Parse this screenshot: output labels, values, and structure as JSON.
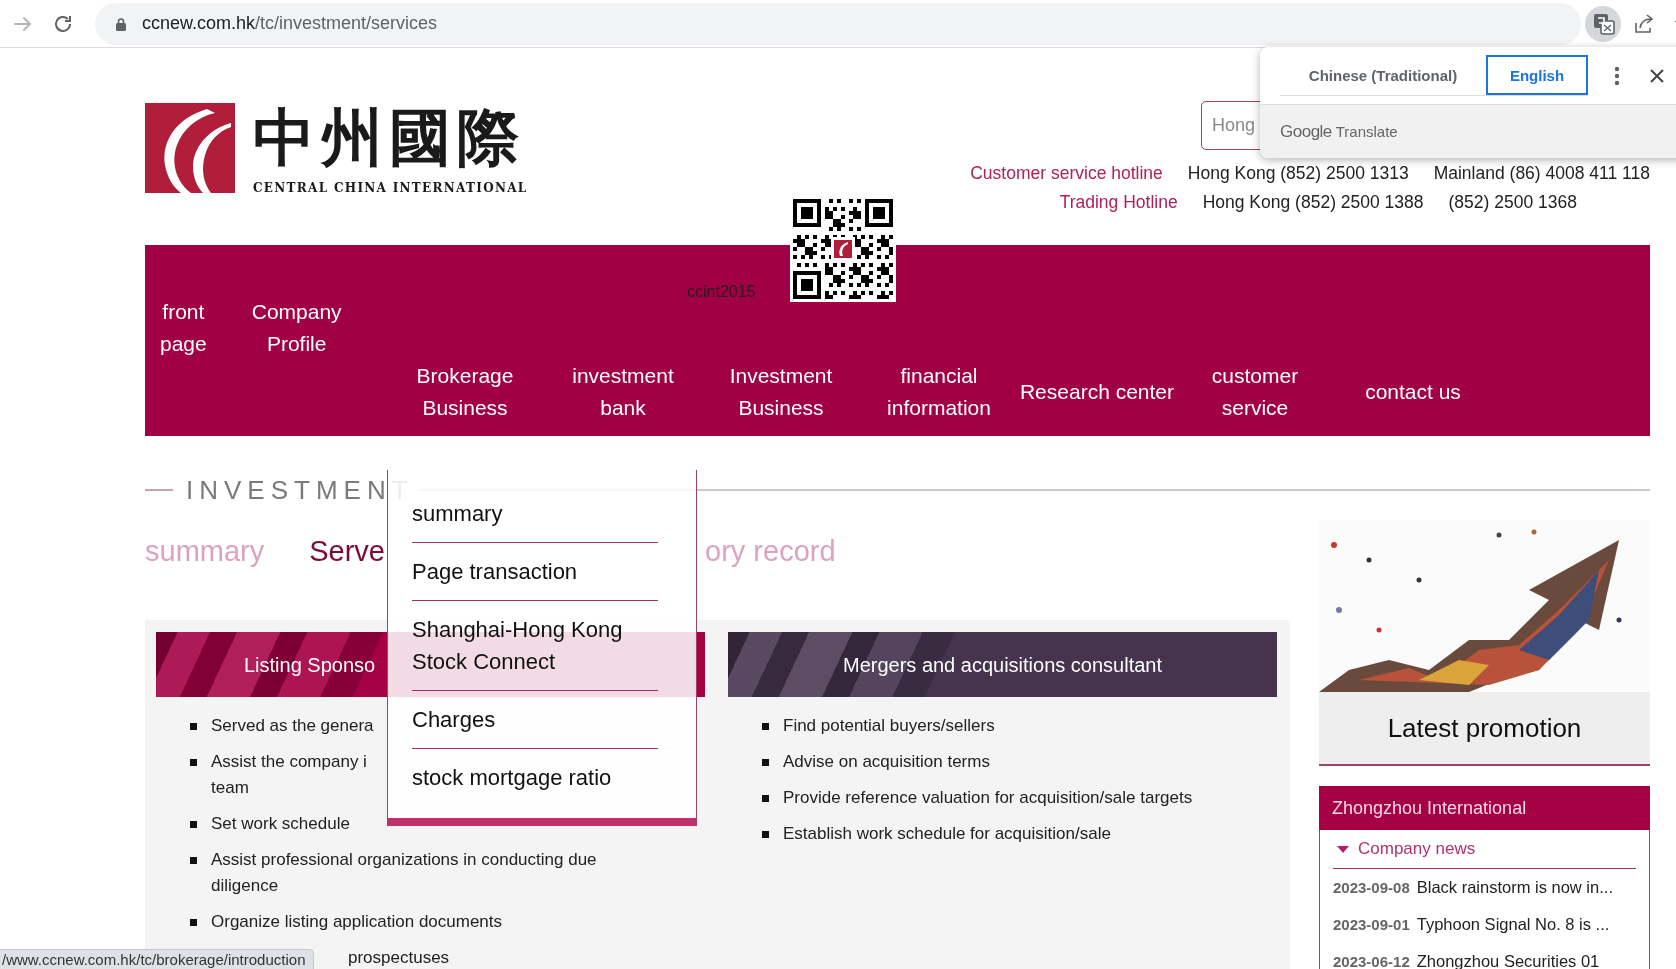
{
  "browser": {
    "nav_buttons": [
      {
        "kind": "forward",
        "disabled": true
      },
      {
        "kind": "reload",
        "disabled": false
      }
    ],
    "url": {
      "host": "ccnew.com.hk",
      "path": "/tc/investment/services"
    },
    "actions": [
      {
        "kind": "translate",
        "active": true
      },
      {
        "kind": "share",
        "active": false
      },
      {
        "kind": "bookmark",
        "active": false
      }
    ]
  },
  "translate_popup": {
    "tabs": [
      {
        "label": "Chinese (Traditional)",
        "selected": false
      },
      {
        "label": "English",
        "selected": true
      }
    ],
    "brand": "Google",
    "product": "Translate"
  },
  "header": {
    "logo": {
      "chinese": "中州國際",
      "english": "CENTRAL CHINA INTERNATIONAL"
    },
    "search": {
      "placeholder": "Hong"
    },
    "hotlines": [
      {
        "label": "Customer service hotline",
        "numbers": [
          "Hong Kong (852) 2500 1313",
          "Mainland (86) 4008 411 118"
        ]
      },
      {
        "label": "Trading Hotline",
        "numbers": [
          "Hong Kong (852) 2500 1388",
          "(852) 2500 1368"
        ]
      }
    ],
    "wechat_id": "ccint2015"
  },
  "nav": {
    "items": [
      {
        "label": "front\npage"
      },
      {
        "label": "Company\nProfile"
      },
      {
        "label": "Brokerage\nBusiness"
      },
      {
        "label": "investment\nbank"
      },
      {
        "label": "Investment\nBusiness"
      },
      {
        "label": "financial\ninformation"
      },
      {
        "label": "Research center"
      },
      {
        "label": "customer\nservice"
      },
      {
        "label": "contact us"
      }
    ]
  },
  "section": {
    "title": "INVESTMENT",
    "tabs": [
      {
        "label": "summary",
        "selected": false
      },
      {
        "label": "Serve",
        "selected": true
      },
      {
        "label": "ory record",
        "selected": false
      }
    ]
  },
  "dropdown": {
    "items": [
      {
        "label": "summary"
      },
      {
        "label": "Page transaction"
      },
      {
        "label": "Shanghai-Hong Kong Stock Connect"
      },
      {
        "label": "Charges"
      },
      {
        "label": "stock mortgage ratio"
      }
    ]
  },
  "cards": [
    {
      "title": "Listing Sponso",
      "covered": true,
      "color": "#a50044",
      "items": [
        {
          "text": "Served as the genera",
          "covered": false
        },
        {
          "text": "Assist the company i\nteam",
          "covered": false
        },
        {
          "text": "Set work schedule",
          "covered": false
        },
        {
          "text": "Assist professional organizations in conducting due diligence",
          "covered": false
        },
        {
          "text": "Organize listing application documents",
          "covered": false
        },
        {
          "text": "prospectuses",
          "covered": true
        }
      ]
    },
    {
      "title": "Mergers and acquisitions consultant",
      "covered": false,
      "color": "#46344f",
      "items": [
        {
          "text": "Find potential buyers/sellers",
          "covered": false
        },
        {
          "text": "Advise on acquisition terms",
          "covered": false
        },
        {
          "text": "Provide reference valuation for acquisition/sale targets",
          "covered": false
        },
        {
          "text": "Establish work schedule for acquisition/sale",
          "covered": false
        }
      ]
    }
  ],
  "sidebar": {
    "promotion": "Latest promotion",
    "news_box": {
      "title": "Zhongzhou International",
      "category": {
        "label": "Company news",
        "expanded": true
      },
      "items": [
        {
          "date": "2023-09-08",
          "title": "Black rainstorm is now in..."
        },
        {
          "date": "2023-09-01",
          "title": "Typhoon Signal No. 8 is ..."
        },
        {
          "date": "2023-06-12",
          "title": "Zhongzhou Securities 01"
        }
      ]
    }
  },
  "status_bubble": {
    "url": "/www.ccnew.com.hk/tc/brokerage/introduction"
  }
}
